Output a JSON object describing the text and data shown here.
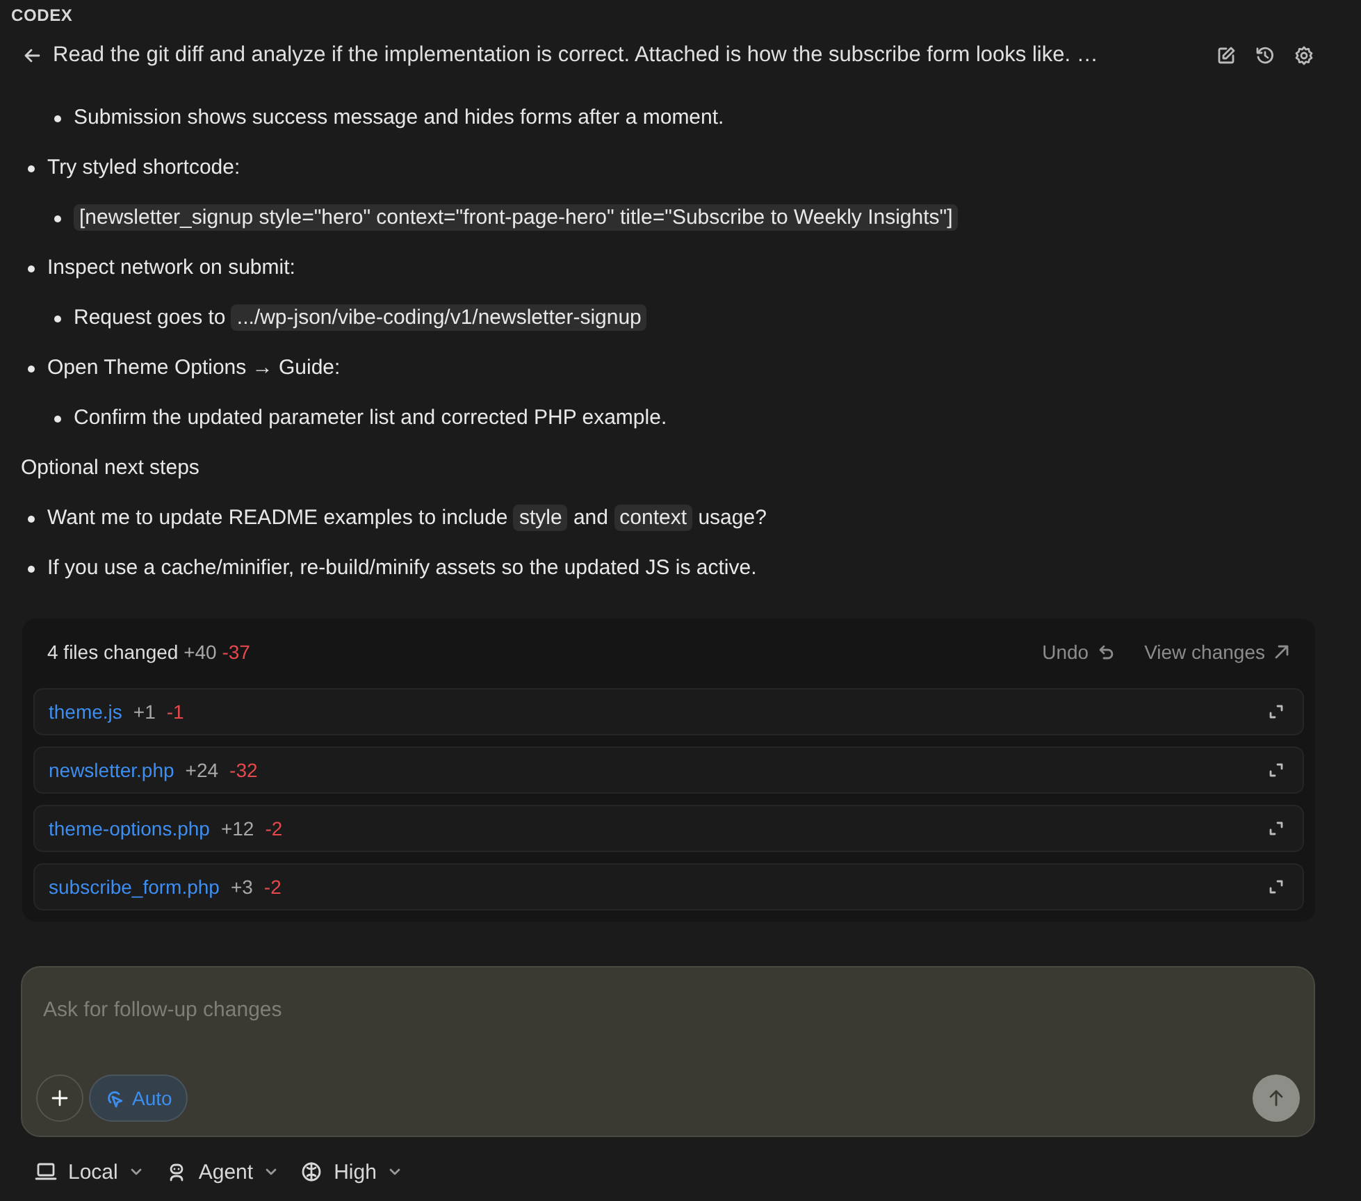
{
  "app": {
    "name": "CODEX"
  },
  "thread": {
    "title": "Read the git diff and analyze if the implementation is correct. Attached is how the subscribe form looks like. …"
  },
  "content": [
    {
      "kind": "nested",
      "children": [
        {
          "parts": [
            {
              "kind": "text",
              "text": "Submission shows success message and hides forms after a moment."
            }
          ]
        }
      ]
    },
    {
      "kind": "bullet",
      "parts": [
        {
          "kind": "text",
          "text": "Try styled shortcode:"
        }
      ],
      "children": [
        {
          "parts": [
            {
              "kind": "code",
              "text": "[newsletter_signup style=\"hero\" context=\"front-page-hero\" title=\"Subscribe to Weekly Insights\"]"
            }
          ]
        }
      ]
    },
    {
      "kind": "bullet",
      "parts": [
        {
          "kind": "text",
          "text": "Inspect network on submit:"
        }
      ],
      "children": [
        {
          "parts": [
            {
              "kind": "text",
              "text": "Request goes to "
            },
            {
              "kind": "code",
              "text": ".../wp-json/vibe-coding/v1/newsletter-signup"
            }
          ]
        }
      ]
    },
    {
      "kind": "bullet",
      "parts": [
        {
          "kind": "text",
          "text": "Open Theme Options → Guide:"
        }
      ],
      "children": [
        {
          "parts": [
            {
              "kind": "text",
              "text": "Confirm the updated parameter list and corrected PHP example."
            }
          ]
        }
      ]
    },
    {
      "kind": "paragraph",
      "parts": [
        {
          "kind": "text",
          "text": "Optional next steps"
        }
      ]
    },
    {
      "kind": "bullet",
      "parts": [
        {
          "kind": "text",
          "text": "Want me to update README examples to include "
        },
        {
          "kind": "code",
          "text": "style"
        },
        {
          "kind": "text",
          "text": " and "
        },
        {
          "kind": "code",
          "text": "context"
        },
        {
          "kind": "text",
          "text": " usage?"
        }
      ]
    },
    {
      "kind": "bullet",
      "parts": [
        {
          "kind": "text",
          "text": "If you use a cache/minifier, re-build/minify assets so the updated JS is active."
        }
      ]
    }
  ],
  "changes": {
    "summary": "4 files changed",
    "added": "+40",
    "removed": "-37",
    "undo": "Undo",
    "view": "View changes",
    "files": [
      {
        "name": "theme.js",
        "added": "+1",
        "removed": "-1"
      },
      {
        "name": "newsletter.php",
        "added": "+24",
        "removed": "-32"
      },
      {
        "name": "theme-options.php",
        "added": "+12",
        "removed": "-2"
      },
      {
        "name": "subscribe_form.php",
        "added": "+3",
        "removed": "-2"
      }
    ]
  },
  "composer": {
    "placeholder": "Ask for follow-up changes",
    "mode": "Auto"
  },
  "footer": [
    {
      "kind": "local",
      "label": "Local"
    },
    {
      "kind": "agent",
      "label": "Agent"
    },
    {
      "kind": "brain",
      "label": "High"
    }
  ]
}
